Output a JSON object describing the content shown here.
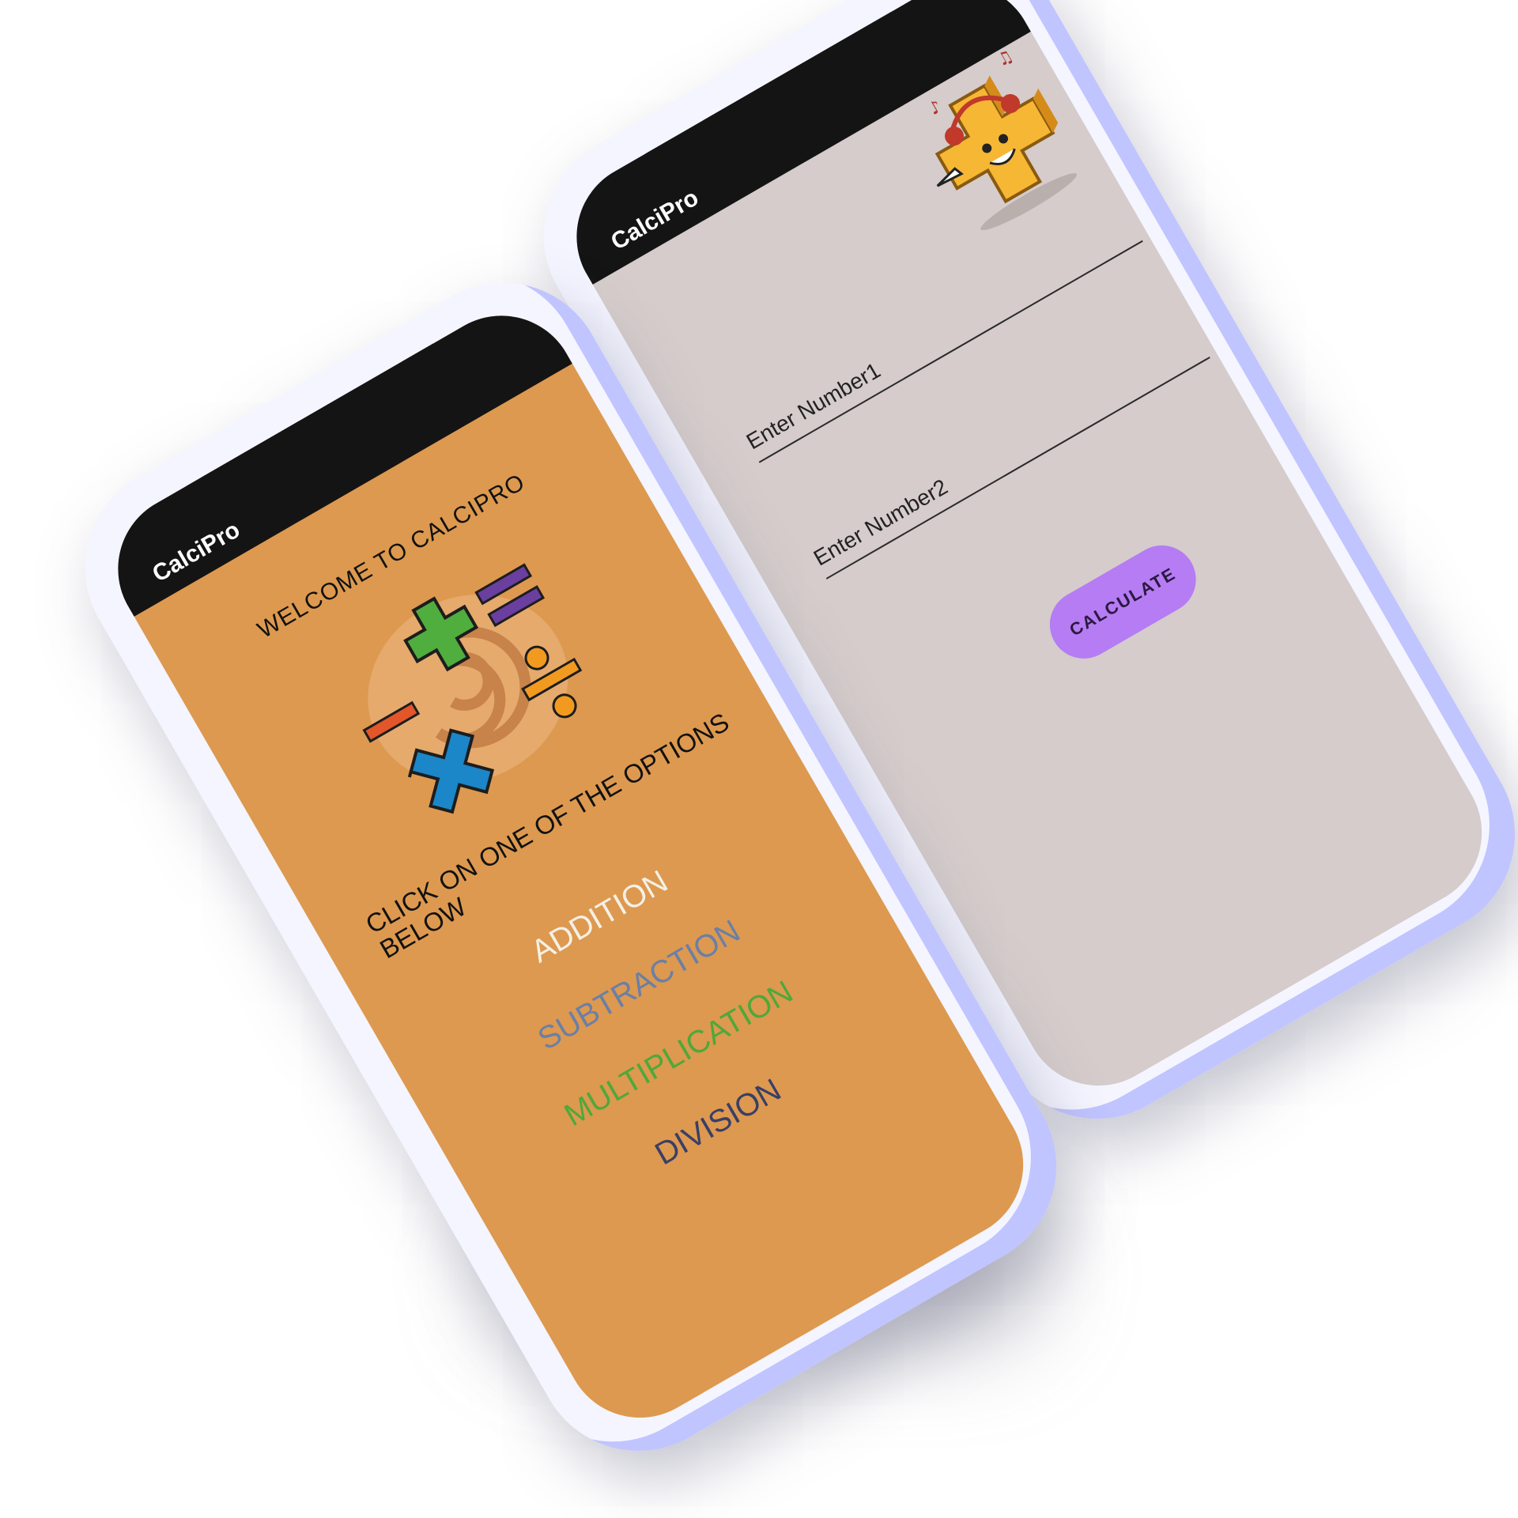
{
  "back_phone": {
    "app_title": "CalciPro",
    "fields": [
      {
        "label": "Enter Number1"
      },
      {
        "label": "Enter Number2"
      }
    ],
    "button_label": "CALCULATE"
  },
  "front_phone": {
    "app_title": "CalciPro",
    "welcome": "WELCOME TO CALCIPRO",
    "prompt": "CLICK ON ONE OF THE OPTIONS BELOW",
    "options": [
      {
        "label": "ADDITION",
        "color": "#f4f0e6"
      },
      {
        "label": "SUBTRACTION",
        "color": "#6b7fa6"
      },
      {
        "label": "MULTIPLICATION",
        "color": "#4fa83a"
      },
      {
        "label": "DIVISION",
        "color": "#3a3f66"
      }
    ]
  },
  "colors": {
    "back_screen": "#d5cccb",
    "front_screen": "#dd994f",
    "button": "#b57cf4",
    "topbar": "#141414"
  },
  "icons": [
    "plus-mascot-icon",
    "math-symbols-logo-icon"
  ]
}
